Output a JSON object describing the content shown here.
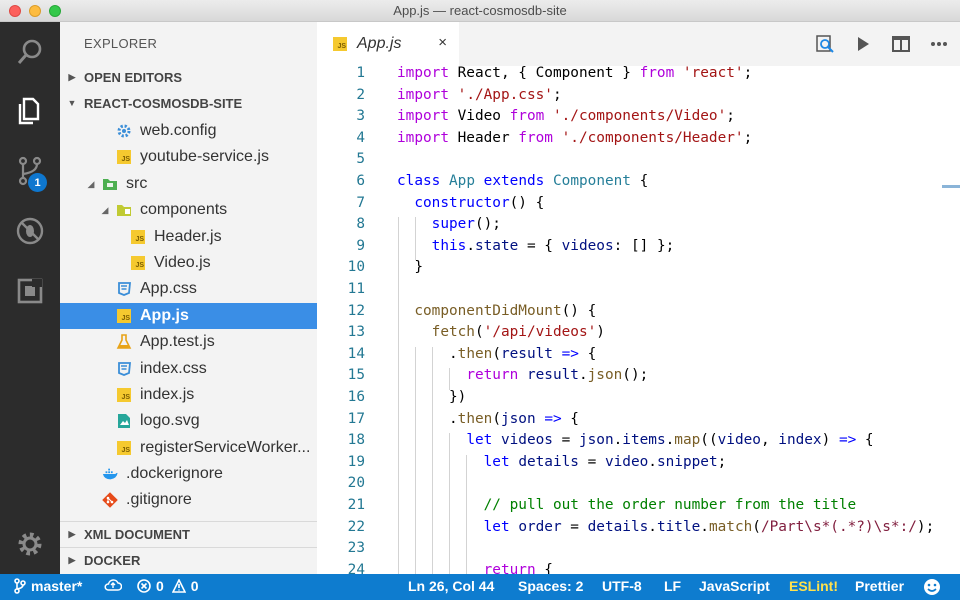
{
  "window": {
    "title": "App.js — react-cosmosdb-site"
  },
  "activity_bar": {
    "scm_badge": "1"
  },
  "sidebar": {
    "title": "EXPLORER",
    "sections": {
      "open_editors": "OPEN EDITORS",
      "project": "REACT-COSMOSDB-SITE",
      "xml": "XML DOCUMENT",
      "docker": "DOCKER"
    },
    "tree": [
      {
        "label": "web.config",
        "icon": "gear-icon"
      },
      {
        "label": "youtube-service.js",
        "icon": "js-file-icon"
      },
      {
        "label": "src",
        "icon": "folder-icon"
      },
      {
        "label": "components",
        "icon": "folder-icon"
      },
      {
        "label": "Header.js",
        "icon": "js-file-icon"
      },
      {
        "label": "Video.js",
        "icon": "js-file-icon"
      },
      {
        "label": "App.css",
        "icon": "css-file-icon"
      },
      {
        "label": "App.js",
        "icon": "js-file-icon",
        "selected": true
      },
      {
        "label": "App.test.js",
        "icon": "flask-icon"
      },
      {
        "label": "index.css",
        "icon": "css-file-icon"
      },
      {
        "label": "index.js",
        "icon": "js-file-icon"
      },
      {
        "label": "logo.svg",
        "icon": "image-file-icon"
      },
      {
        "label": "registerServiceWorker...",
        "icon": "js-file-icon"
      },
      {
        "label": ".dockerignore",
        "icon": "docker-icon"
      },
      {
        "label": ".gitignore",
        "icon": "git-icon"
      }
    ]
  },
  "editor": {
    "tab": {
      "label": "App.js",
      "close": "×"
    },
    "line_numbers": [
      "1",
      "2",
      "3",
      "4",
      "5",
      "6",
      "7",
      "8",
      "9",
      "10",
      "11",
      "12",
      "13",
      "14",
      "15",
      "16",
      "17",
      "18",
      "19",
      "20",
      "21",
      "22",
      "23",
      "24"
    ],
    "code_lines": [
      "import React, { Component } from 'react';",
      "import './App.css';",
      "import Video from './components/Video';",
      "import Header from './components/Header';",
      "",
      "class App extends Component {",
      "  constructor() {",
      "    super();",
      "    this.state = { videos: [] };",
      "  }",
      "",
      "  componentDidMount() {",
      "    fetch('/api/videos')",
      "      .then(result => {",
      "        return result.json();",
      "      })",
      "      .then(json => {",
      "        let videos = json.items.map((video, index) => {",
      "          let details = video.snippet;",
      "",
      "          // pull out the order number from the title",
      "          let order = details.title.match(/Part\\s*(.*?)\\s*:/);",
      "",
      "          return {"
    ]
  },
  "statusbar": {
    "branch": "master*",
    "errors": "0",
    "warnings": "0",
    "position": "Ln 26, Col 44",
    "spaces": "Spaces: 2",
    "encoding": "UTF-8",
    "eol": "LF",
    "language": "JavaScript",
    "eslint": "ESLint!",
    "prettier": "Prettier"
  },
  "colors": {
    "statusbar": "#0e7ccf",
    "activity_bar": "#2c2c2c",
    "selection": "#3a8ee6"
  }
}
